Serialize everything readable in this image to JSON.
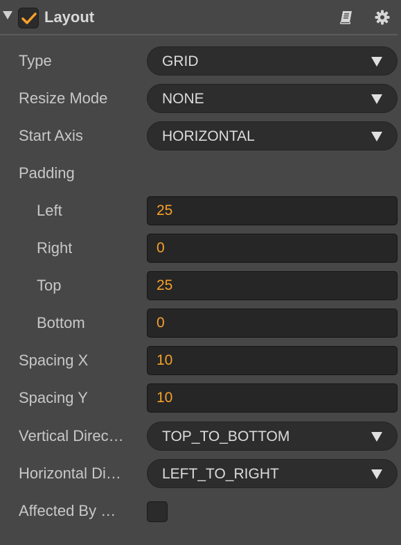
{
  "header": {
    "title": "Layout",
    "enabled": true
  },
  "fields": {
    "type": {
      "label": "Type",
      "value": "GRID"
    },
    "resize_mode": {
      "label": "Resize Mode",
      "value": "NONE"
    },
    "start_axis": {
      "label": "Start Axis",
      "value": "HORIZONTAL"
    },
    "padding": {
      "label": "Padding"
    },
    "padding_left": {
      "label": "Left",
      "value": "25"
    },
    "padding_right": {
      "label": "Right",
      "value": "0"
    },
    "padding_top": {
      "label": "Top",
      "value": "25"
    },
    "padding_bottom": {
      "label": "Bottom",
      "value": "0"
    },
    "spacing_x": {
      "label": "Spacing X",
      "value": "10"
    },
    "spacing_y": {
      "label": "Spacing Y",
      "value": "10"
    },
    "vertical_direction": {
      "label": "Vertical Direc…",
      "value": "TOP_TO_BOTTOM"
    },
    "horizontal_direction": {
      "label": "Horizontal Di…",
      "value": "LEFT_TO_RIGHT"
    },
    "affected_by_scale": {
      "label": "Affected By …",
      "checked": false
    }
  },
  "colors": {
    "background": "#474747",
    "accent_orange": "#f7a12a",
    "label_text": "#c8c8c8",
    "input_bg": "#262626"
  },
  "icons": {
    "collapse": "triangle-down",
    "enable": "check-icon",
    "docs": "book-icon",
    "settings": "gear-icon"
  }
}
